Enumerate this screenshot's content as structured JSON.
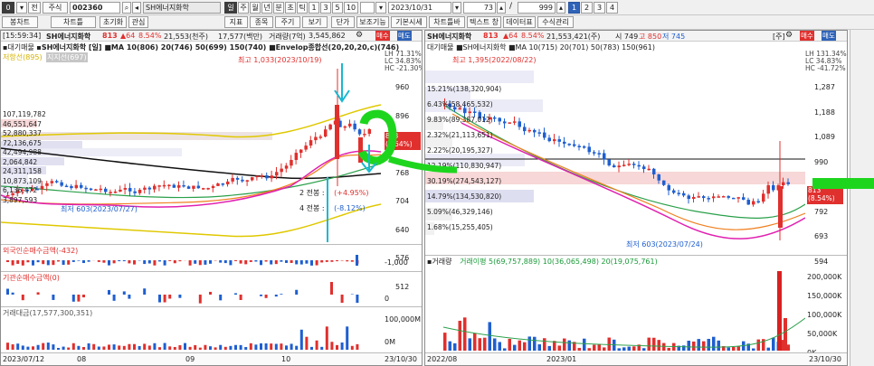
{
  "toolbar1": {
    "screen_no": "0",
    "menu_label": "전",
    "market_label": "주식",
    "code": "002360",
    "stock_name": "SH에너지화학",
    "btn_year": "년",
    "period_day": "일",
    "period_week": "주",
    "period_month": "월",
    "period_year": "년",
    "period_min": "분",
    "period_tick": "초",
    "period_tick2": "틱",
    "period_values": [
      "1",
      "3",
      "5",
      "10"
    ],
    "date": "2023/10/31",
    "count1": "73",
    "count2": "999",
    "pages": [
      "1",
      "2",
      "3",
      "4"
    ]
  },
  "toolbar2": {
    "items": [
      "봉차트",
      "차트틀",
      "초기화",
      "관심",
      "지표",
      "종목",
      "주기",
      "보기",
      "단가",
      "보조기능",
      "기본시세",
      "차트틀바",
      "텍스트 창",
      "데이터표",
      "수식관리"
    ]
  },
  "left_chart": {
    "time": "15:59:34",
    "name": "SH에너지화학",
    "price": "813",
    "change": "▲64",
    "pct": "8.54%",
    "volume": "21,553(천주)",
    "amount": "17,577(백만)",
    "trade_label": "거래량(7억)",
    "trade_value": "3,545,862",
    "sell_btn": "매수",
    "buy_btn": "매도",
    "title_label": "대기매물",
    "ma_line": "SH에너지화학 [일] ■MA 10(806) 20(746) 50(699) 150(740) ■Envelop종합선(20,20,20,c)(746)",
    "side_label": "저항선(895)",
    "side_label2": "지지선(697)",
    "max_label": "최고 1,033(2023/10/19)",
    "min_label": "최저 603(2023/07/27)",
    "annot1": "2 전봉 :",
    "annot1_val": "(+4.95%)",
    "annot2": "4 전봉 :",
    "annot2_val": "(-8.12%)",
    "lh": "LH  71.31%",
    "lc": "LC  34.83%",
    "hc": "HC  -21.30%",
    "price_tag": "813",
    "price_tag_pct": "(8.54%)",
    "y_ticks": [
      "960",
      "896",
      "832",
      "768",
      "704",
      "640",
      "576",
      "512"
    ],
    "vp_labels": [
      "107,119,782",
      "46,551,647",
      "52,880,337",
      "72,136,675",
      "42,494,988",
      "2,064,842",
      "24,311,158",
      "10,873,109",
      "6,136,472",
      "3,897,593"
    ],
    "foreign_title": "외국인순매수금액(-432)",
    "foreign_ticks": [
      "-1,000"
    ],
    "inst_title": "기관순매수금액(0)",
    "inst_ticks": [
      "0"
    ],
    "amount_title": "거래대금(17,577,300,351)",
    "amount_ticks": [
      "100,000M",
      "0M"
    ],
    "x_labels": [
      "2023/07/12",
      "08",
      "09",
      "10",
      "23/10/30"
    ]
  },
  "right_chart": {
    "name": "SH에너지화학",
    "price": "813",
    "change": "▲64",
    "pct": "8.54%",
    "volume": "21,553,421(주)",
    "open": "시 749",
    "high": "고 850",
    "low": "저 745",
    "week_label": "[주]",
    "sell_btn": "매수",
    "buy_btn": "매도",
    "ma_line": "대기매물 ■SH에너지화학 ■MA 10(715) 20(701) 50(783) 150(961)",
    "max_label": "최고 1,395(2022/08/22)",
    "min_label": "최저 603(2023/07/24)",
    "lh": "LH 131.34%",
    "lc": "LC  34.83%",
    "hc": "HC  -41.72%",
    "price_tag": "813",
    "price_tag_pct": "(8.54%)",
    "y_ticks": [
      "1,287",
      "1,188",
      "1,089",
      "990",
      "891",
      "792",
      "693",
      "594"
    ],
    "vp_labels": [
      "15.21%(138,320,904)",
      "6.43%(58,465,532)",
      "9.83%(89,387,012)",
      "2.32%(21,113,651)",
      "2.22%(20,195,327)",
      "12.19%(110,830,947)",
      "30.19%(274,543,127)",
      "14.79%(134,530,820)",
      "5.09%(46,329,146)",
      "1.68%(15,255,405)"
    ],
    "vol_title": "거래량",
    "vol_ma": "거래이평 5(69,757,889) 10(36,065,498) 20(19,075,761)",
    "vol_ticks": [
      "200,000K",
      "150,000K",
      "100,000K",
      "50,000K",
      "0K"
    ],
    "x_labels": [
      "2022/08",
      "2023/01",
      "23/10/30"
    ]
  },
  "colors": {
    "up": "#e0302e",
    "down": "#1f5fd0",
    "green_highlight": "#1ed51e",
    "cyan_annotation": "#18b8d0"
  }
}
